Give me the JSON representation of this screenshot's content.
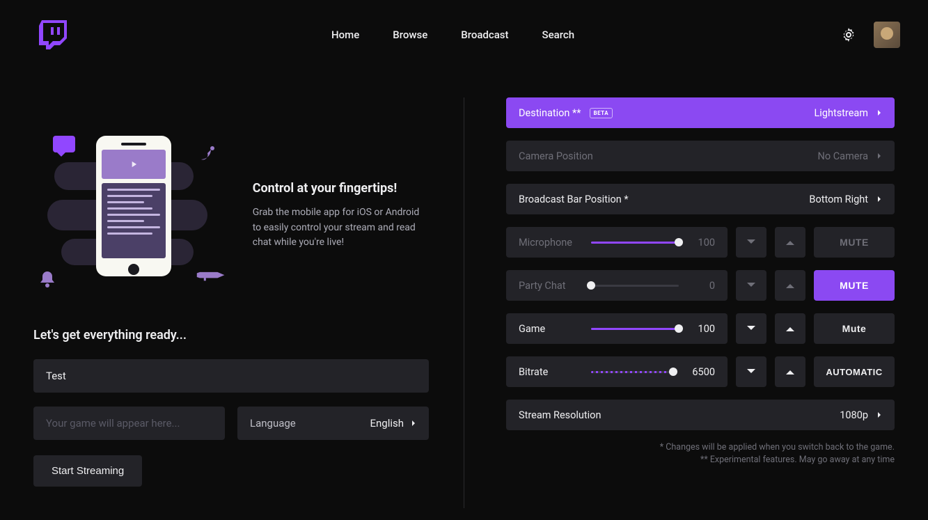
{
  "nav": {
    "home": "Home",
    "browse": "Browse",
    "broadcast": "Broadcast",
    "search": "Search"
  },
  "promo": {
    "title": "Control at your fingertips!",
    "body": "Grab the mobile app for iOS or Android to easily control your stream and read chat while you're live!"
  },
  "ready_title": "Let's get everything ready...",
  "title_value": "Test",
  "game_placeholder": "Your game will appear here...",
  "language": {
    "label": "Language",
    "value": "English"
  },
  "start_label": "Start Streaming",
  "settings": {
    "destination": {
      "label": "Destination **",
      "beta": "BETA",
      "value": "Lightstream"
    },
    "camera": {
      "label": "Camera Position",
      "value": "No Camera"
    },
    "barpos": {
      "label": "Broadcast Bar Position *",
      "value": "Bottom Right"
    },
    "mic": {
      "label": "Microphone",
      "value": "100",
      "mute": "MUTE"
    },
    "party": {
      "label": "Party Chat",
      "value": "0",
      "mute": "MUTE"
    },
    "game": {
      "label": "Game",
      "value": "100",
      "mute": "Mute"
    },
    "bitrate": {
      "label": "Bitrate",
      "value": "6500",
      "auto": "AUTOMATIC"
    },
    "resolution": {
      "label": "Stream Resolution",
      "value": "1080p"
    }
  },
  "footnote1": "* Changes will be applied when you switch back to the game.",
  "footnote2": "** Experimental features. May go away at any time"
}
